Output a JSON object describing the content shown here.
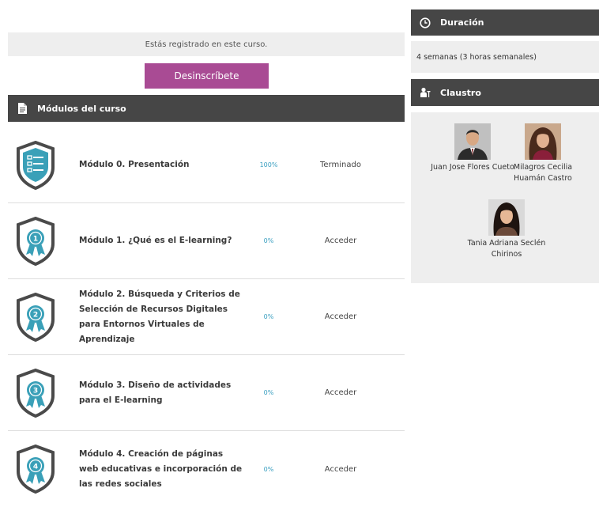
{
  "registration": {
    "notice": "Estás registrado en este curso.",
    "unsubscribe_label": "Desinscríbete"
  },
  "modules_section": {
    "title": "Módulos del curso",
    "items": [
      {
        "title": "Módulo 0. Presentación",
        "progress": "100%",
        "status": "Terminado",
        "badge": "list-icon"
      },
      {
        "title": "Módulo 1. ¿Qué es el E-learning?",
        "progress": "0%",
        "status": "Acceder",
        "badge": "ribbon-1"
      },
      {
        "title": "Módulo 2. Búsqueda y Criterios de Selección de Recursos Digitales para Entornos Virtuales de Aprendizaje",
        "progress": "0%",
        "status": "Acceder",
        "badge": "ribbon-2"
      },
      {
        "title": "Módulo 3. Diseño de actividades para el E-learning",
        "progress": "0%",
        "status": "Acceder",
        "badge": "ribbon-3"
      },
      {
        "title": "Módulo 4. Creación de páginas web educativas e incorporación de las redes sociales",
        "progress": "0%",
        "status": "Acceder",
        "badge": "ribbon-4"
      }
    ]
  },
  "duration": {
    "title": "Duración",
    "value": "4 semanas (3 horas semanales)"
  },
  "faculty": {
    "title": "Claustro",
    "members": [
      {
        "name": "Juan Jose Flores Cueto"
      },
      {
        "name": "Milagros Cecilia Huamán Castro"
      },
      {
        "name": "Tania Adriana Seclén Chirinos"
      }
    ]
  },
  "colors": {
    "header_bg": "#464646",
    "panel_bg": "#eeeeee",
    "button_bg": "#a94b94",
    "progress_text": "#3a9fc0",
    "badge_teal": "#3aa0b8",
    "badge_border": "#4a4a4a"
  }
}
